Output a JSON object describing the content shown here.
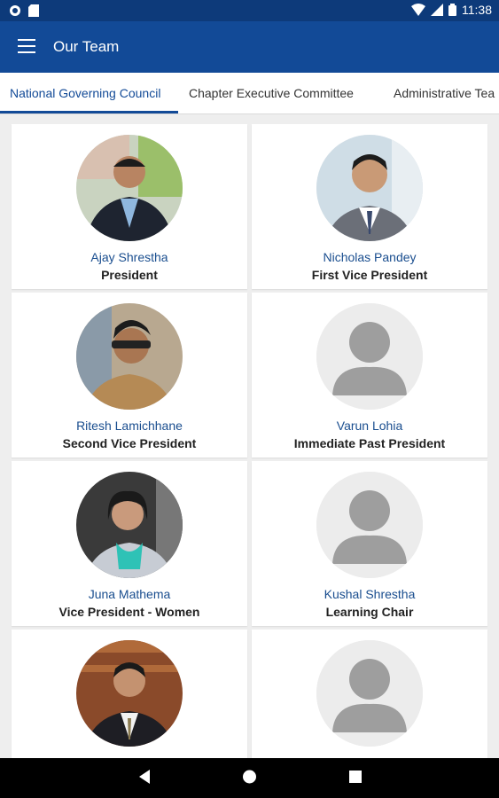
{
  "status_bar": {
    "time": "11:38"
  },
  "app_bar": {
    "title": "Our Team"
  },
  "tabs": [
    {
      "label": "National Governing Council",
      "active": true
    },
    {
      "label": "Chapter Executive Committee",
      "active": false
    },
    {
      "label": "Administrative Tea",
      "active": false
    }
  ],
  "members": [
    {
      "name": "Ajay Shrestha",
      "role": "President",
      "photo": "photo"
    },
    {
      "name": "Nicholas Pandey",
      "role": "First Vice President",
      "photo": "photo"
    },
    {
      "name": "Ritesh Lamichhane",
      "role": "Second Vice President",
      "photo": "photo"
    },
    {
      "name": "Varun Lohia",
      "role": "Immediate Past President",
      "photo": "placeholder"
    },
    {
      "name": "Juna Mathema",
      "role": "Vice President - Women",
      "photo": "photo"
    },
    {
      "name": "Kushal Shrestha",
      "role": "Learning Chair",
      "photo": "placeholder"
    },
    {
      "name": "",
      "role": "",
      "photo": "photo"
    },
    {
      "name": "",
      "role": "",
      "photo": "placeholder"
    }
  ],
  "colors": {
    "status_bar": "#0d3a7a",
    "app_bar": "#124a97",
    "accent": "#124a97",
    "name_text": "#1a4e8f"
  }
}
